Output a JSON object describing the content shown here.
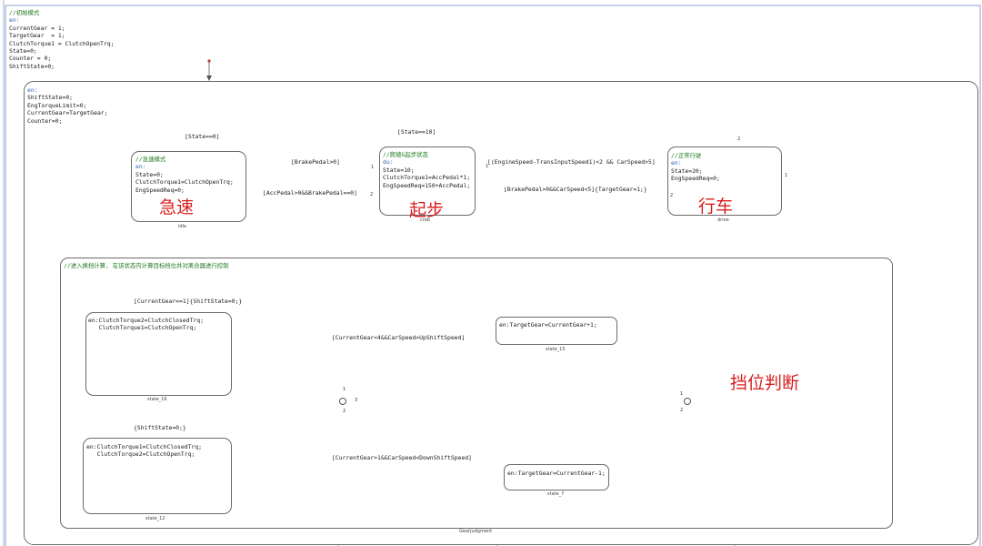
{
  "init_block": {
    "comment": "//初始模式",
    "entry": "en:",
    "lines": [
      "CurrentGear = 1;",
      "TargetGear  = 1;",
      "ClutchTorque1 = ClutchOpenTrq;",
      "State=0;",
      "Counter = 0;",
      "ShiftState=0;"
    ]
  },
  "parent_state": {
    "entry": "en:",
    "lines": [
      "ShiftState=0;",
      "EngTorqueLimit=0;",
      "CurrentGear=TargetGear;",
      "Counter=0;"
    ]
  },
  "states": {
    "idle": {
      "comment": "//急速模式",
      "entry": "en:",
      "lines": [
        "State=0;",
        "ClutchTorque1=ClutchOpenTrq;",
        "EngSpeedReq=0;"
      ],
      "name": "idle",
      "big_label": "急速"
    },
    "creb": {
      "comment": "//爬坡&起步状态",
      "entry": "du:",
      "lines": [
        "State=10;",
        "ClutchTorque1=AccPedal*1;",
        "EngSpeedReq=150+AccPedal;"
      ],
      "name": "creb",
      "big_label": "起步"
    },
    "drive": {
      "comment": "//正常行驶",
      "entry": "en:",
      "lines": [
        "State=20;",
        "EngSpeedReq=0;"
      ],
      "name": "drive",
      "big_label": "行车"
    }
  },
  "transitions": {
    "idle_default": "[State==0]",
    "creb_default": "[State==10]",
    "creb_to_idle": "[BrakePedal>0]",
    "idle_to_creb": "[AccPedal>0&&BrakePedal==0]",
    "creb_to_drive": "[(EngineSpeed-TransInputSpeed1)<2 && CarSpeed>5]",
    "drive_to_creb": "[BrakePedal>0&&CarSpeed<5]{TargetGear=1;}"
  },
  "gear_judgment": {
    "comment": "//进入换挡计算, 在该状态内计算目标挡位并对离合器进行控制",
    "name": "Gearjudgment",
    "big_label": "挡位判断",
    "default_16": "[CurrentGear==1]{ShiftState=0;}",
    "default_12": "{ShiftState=0;}",
    "upshift": "[CurrentGear<4&&CarSpeed>UpShiftSpeed]",
    "downshift": "[CurrentGear>1&&CarSpeed<DownShiftSpeed]",
    "state_16": {
      "name": "state_16",
      "lines": [
        "en:ClutchTorque2=ClutchClosedTrq;",
        "   ClutchTorque1=ClutchOpenTrq;"
      ]
    },
    "state_12": {
      "name": "state_12",
      "lines": [
        "en:ClutchTorque1=ClutchClosedTrq;",
        "   ClutchTorque2=ClutchOpenTrq;"
      ]
    },
    "state_15": {
      "name": "state_15",
      "text": "en:TargetGear=CurrentGear+1;"
    },
    "state_7": {
      "name": "state_7",
      "text": "en:TargetGear=CurrentGear-1;"
    }
  },
  "priorities": [
    "1",
    "2",
    "1",
    "2",
    "1",
    "2",
    "3",
    "1",
    "2",
    "3",
    "1",
    "2"
  ]
}
